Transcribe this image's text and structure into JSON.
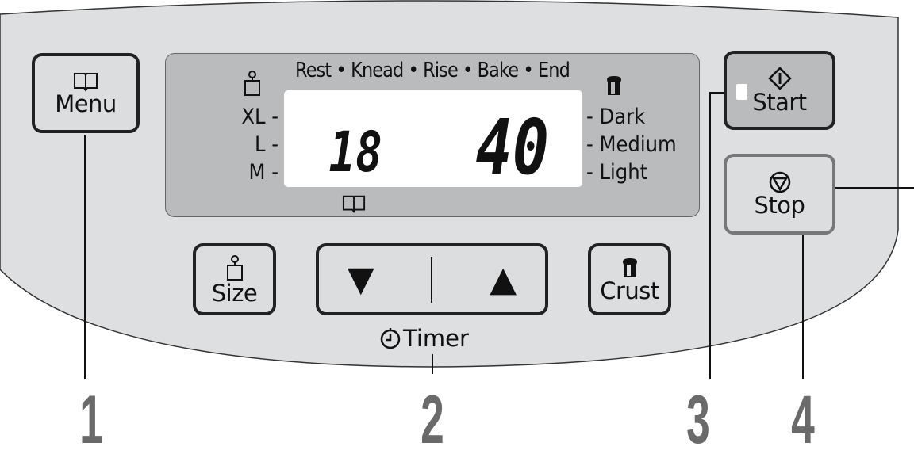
{
  "panel": {
    "menu_button": {
      "label": "Menu",
      "icon": "book-icon"
    },
    "display": {
      "phases": "Rest • Knead • Rise • Bake • End",
      "size_icon": "weight-icon",
      "sizes": [
        "XL -",
        "L -",
        "M -"
      ],
      "crust_icon": "bread-icon",
      "crust_levels": [
        "- Dark",
        "- Medium",
        "- Light"
      ],
      "menu_number": "18",
      "time": "40",
      "menu_indicator_icon": "book-icon"
    },
    "size_button": {
      "label": "Size",
      "icon": "weight-icon"
    },
    "timer_buttons": {
      "down": "▼",
      "up": "▲",
      "label": "Timer",
      "icon": "clock-icon"
    },
    "crust_button": {
      "label": "Crust",
      "icon": "bread-icon"
    },
    "start_button": {
      "label": "Start",
      "icon": "start-diamond-icon",
      "led": "on"
    },
    "stop_button": {
      "label": "Stop",
      "icon": "stop-circle-icon"
    }
  },
  "callouts": [
    "1",
    "2",
    "3",
    "4"
  ],
  "colors": {
    "panel": "#dedfe0",
    "display": "#babbbd",
    "start": "#babbbd",
    "callout": "#6a6a6a"
  }
}
